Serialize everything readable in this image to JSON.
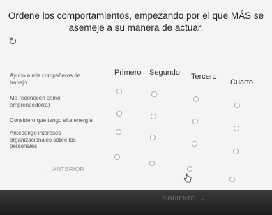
{
  "question": {
    "line1": "Ordene los comportamientos, empezando por el que MÁS se",
    "line2": "asemeje a su manera de actuar."
  },
  "columns": [
    "Primero",
    "Segundo",
    "Tercero",
    "Cuarto"
  ],
  "rows": [
    {
      "line1": "Ayudo a mis compañeros de",
      "line2": "trabajo",
      "line3": ""
    },
    {
      "line1": "Me reconocen como",
      "line2": "emprendedor(a)",
      "line3": ""
    },
    {
      "line1": "Considero que tengo alta energía",
      "line2": "",
      "line3": ""
    },
    {
      "line1": "Antepongo intereses",
      "line2": "organizacionales sobre los",
      "line3": "personales"
    }
  ],
  "nav": {
    "back_label": "ANTERIOR",
    "back_icon": "arrow-left-icon",
    "next_label": "SIGUIENTE",
    "next_icon": "arrow-right-icon"
  },
  "icons": {
    "refresh": "refresh-icon"
  }
}
